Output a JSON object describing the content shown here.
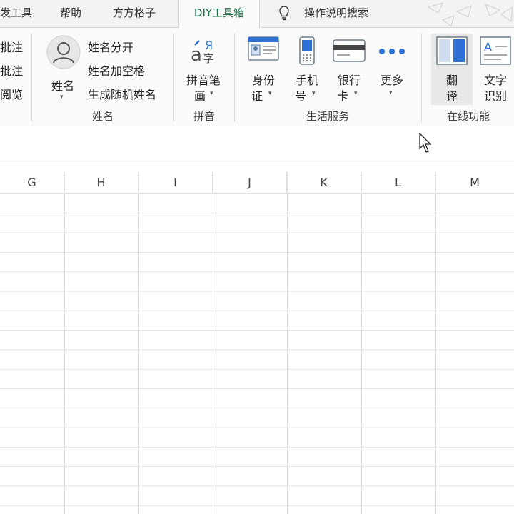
{
  "tabs": [
    {
      "label": "发工具"
    },
    {
      "label": "帮助"
    },
    {
      "label": "方方格子"
    },
    {
      "label": "DIY工具箱",
      "active": true
    }
  ],
  "search": {
    "label": "操作说明搜索",
    "icon": "lightbulb-icon"
  },
  "ribbon": {
    "left_partial": {
      "items": [
        "批注",
        "批注",
        "阅览"
      ]
    },
    "name_group": {
      "label": "姓名",
      "big_button": {
        "label": "姓名",
        "icon": "avatar-icon"
      },
      "items": [
        "姓名分开",
        "姓名加空格",
        "生成随机姓名"
      ]
    },
    "pinyin_group": {
      "label": "拼音",
      "button": {
        "line1": "拼音笔",
        "line2": "画",
        "icon": "pinyin-icon"
      }
    },
    "life_group": {
      "label": "生活服务",
      "buttons": [
        {
          "line1": "身份",
          "line2": "证",
          "icon": "id-card-icon"
        },
        {
          "line1": "手机",
          "line2": "号",
          "icon": "phone-icon"
        },
        {
          "line1": "银行",
          "line2": "卡",
          "icon": "bank-card-icon"
        },
        {
          "line1": "更多",
          "line2": "",
          "icon": "more-icon"
        }
      ]
    },
    "online_group": {
      "label": "在线功能",
      "buttons": [
        {
          "line1": "翻",
          "line2": "译",
          "icon": "translate-icon"
        },
        {
          "line1": "文字",
          "line2": "识别",
          "icon": "ocr-icon"
        }
      ]
    }
  },
  "columns": [
    "G",
    "H",
    "I",
    "J",
    "K",
    "L",
    "M"
  ],
  "colors": {
    "accent": "#1f6e43",
    "ribbon_bg": "#fafafa",
    "tab_bg": "#f3f3f3",
    "icon_blue": "#2e6fd6"
  }
}
